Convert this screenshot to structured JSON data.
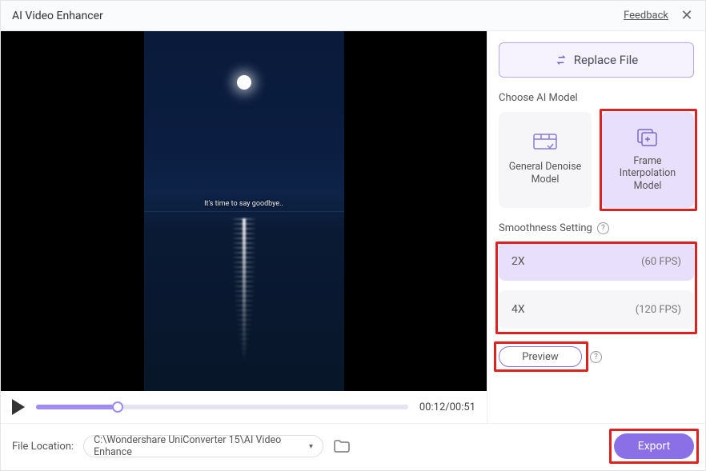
{
  "titlebar": {
    "title": "AI Video Enhancer",
    "feedback": "Feedback",
    "close_glyph": "✕"
  },
  "video": {
    "caption": "It's time to say goodbye..",
    "time_current": "00:12",
    "time_total": "00:51"
  },
  "buttons": {
    "replace": "Replace File",
    "preview": "Preview",
    "export": "Export"
  },
  "sections": {
    "model": "Choose AI Model",
    "smoothness": "Smoothness Setting"
  },
  "models": [
    {
      "id": "denoise",
      "label": "General Denoise Model",
      "active": false
    },
    {
      "id": "frame-interp",
      "label": "Frame Interpolation Model",
      "active": true
    }
  ],
  "smoothness": [
    {
      "mult": "2X",
      "fps": "(60 FPS)",
      "active": true
    },
    {
      "mult": "4X",
      "fps": "(120 FPS)",
      "active": false
    }
  ],
  "footer": {
    "label": "File Location:",
    "path": "C:\\Wondershare UniConverter 15\\AI Video Enhance"
  }
}
